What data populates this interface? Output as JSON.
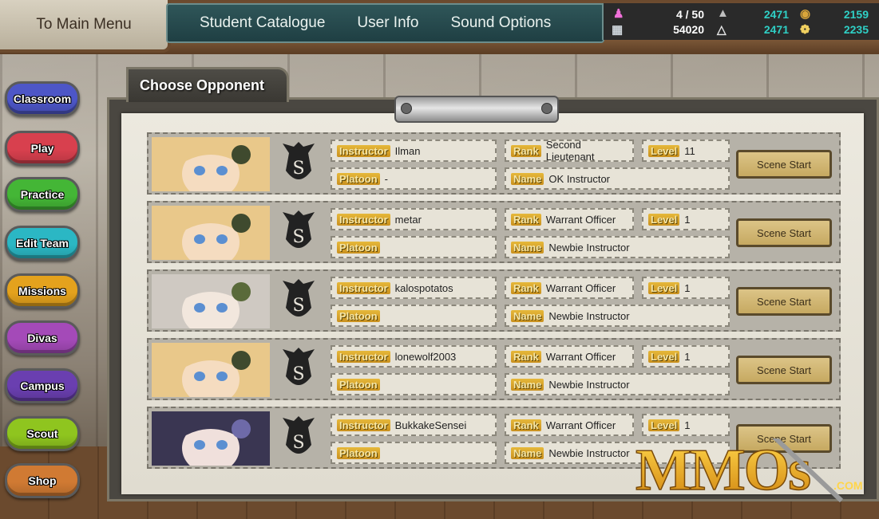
{
  "header": {
    "main_menu_label": "To Main Menu",
    "tabs": [
      "Student Catalogue",
      "User Info",
      "Sound Options"
    ]
  },
  "stats": {
    "students": "4 / 50",
    "currency_silver": "54020",
    "stat_a": "2471",
    "stat_b": "2471",
    "stat_c": "2159",
    "stat_d": "2235"
  },
  "side_menu": [
    {
      "label": "Classroom",
      "color": "#4d56c7"
    },
    {
      "label": "Play",
      "color": "#d8404e"
    },
    {
      "label": "Practice",
      "color": "#44b636"
    },
    {
      "label": "Edit Team",
      "color": "#2bb7c4"
    },
    {
      "label": "Missions",
      "color": "#e4a21d"
    },
    {
      "label": "Divas",
      "color": "#a44ab8"
    },
    {
      "label": "Campus",
      "color": "#6a3fb0"
    },
    {
      "label": "Scout",
      "color": "#8fc51f"
    },
    {
      "label": "Shop",
      "color": "#d07a33"
    }
  ],
  "panel": {
    "title": "Choose Opponent",
    "labels": {
      "instructor": "Instructor",
      "platoon": "Platoon",
      "rank": "Rank",
      "name": "Name",
      "level": "Level"
    },
    "scene_button_label": "Scene Start"
  },
  "opponents": [
    {
      "instructor": "Ilman",
      "platoon": "-",
      "rank": "Second Lieutenant",
      "level": "11",
      "name": "OK Instructor",
      "portrait": "blonde-headset"
    },
    {
      "instructor": "metar",
      "platoon": "",
      "rank": "Warrant Officer",
      "level": "1",
      "name": "Newbie Instructor",
      "portrait": "blonde-headset"
    },
    {
      "instructor": "kalospotatos",
      "platoon": "",
      "rank": "Warrant Officer",
      "level": "1",
      "name": "Newbie Instructor",
      "portrait": "silver-hair"
    },
    {
      "instructor": "lonewolf2003",
      "platoon": "",
      "rank": "Warrant Officer",
      "level": "1",
      "name": "Newbie Instructor",
      "portrait": "blonde-headset"
    },
    {
      "instructor": "BukkakeSensei",
      "platoon": "",
      "rank": "Warrant Officer",
      "level": "1",
      "name": "Newbie Instructor",
      "portrait": "dark-hair"
    }
  ],
  "watermark": {
    "text": "MMOs",
    "suffix": ".COM"
  },
  "colors": {
    "accent_teal": "#2fd0c6",
    "label_gold": "#e6b83a",
    "scene_button": "#d4bb79"
  },
  "icons": [
    "pink-figure-icon",
    "ticket-icon",
    "silver-ingot-icon",
    "silver-pile-icon",
    "gold-coins-icon",
    "gold-pile-icon",
    "platoon-emblem-icon"
  ]
}
